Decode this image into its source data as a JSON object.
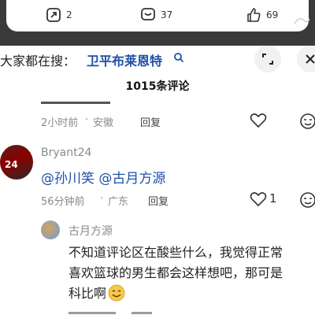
{
  "action_bar": {
    "share_count": "2",
    "comment_count": "37",
    "like_count": "69"
  },
  "search_hint": {
    "prefix": "大家都在搜：",
    "term": "卫平布莱恩特"
  },
  "comments_header": {
    "count_label": "1015条评论"
  },
  "comments": [
    {
      "time": "2小时前",
      "location": "安徽",
      "reply_label": "回复"
    },
    {
      "username": "Bryant24",
      "avatar_text": "24",
      "text": "@孙川笑 @古月方源",
      "time": "56分钟前",
      "location": "广东",
      "reply_label": "回复",
      "likes": "1"
    }
  ],
  "reply": {
    "username": "古月方源",
    "lines": [
      "不知道评论区在酸些什么，我觉得正常",
      "喜欢篮球的男生都会这样想吧，那可是",
      "科比啊"
    ]
  }
}
